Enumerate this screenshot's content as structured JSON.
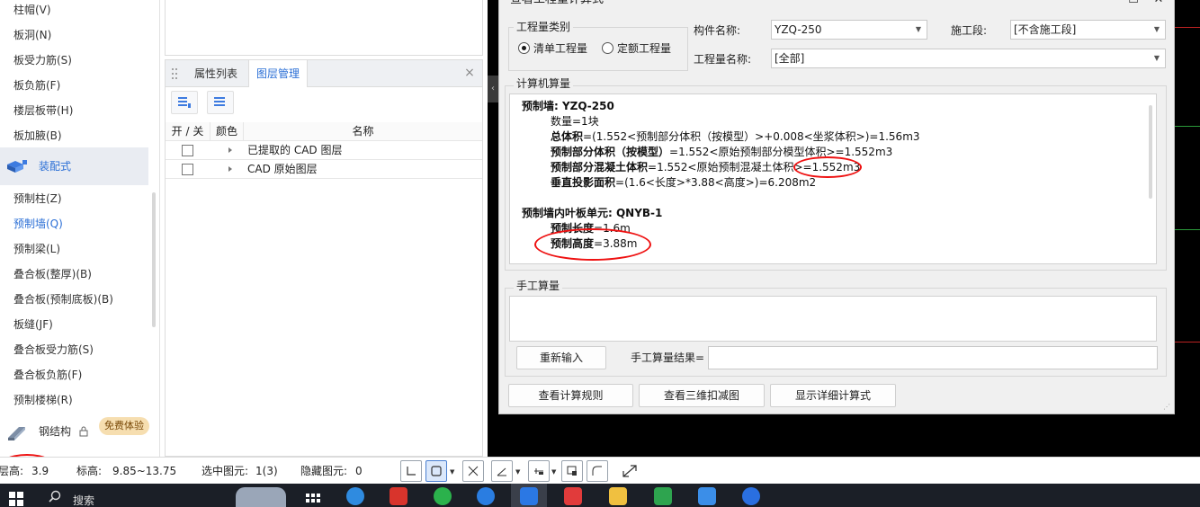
{
  "sidebar": {
    "items_top": [
      "柱帽(V)",
      "板洞(N)",
      "板受力筋(S)",
      "板负筋(F)",
      "楼层板带(H)",
      "板加腋(B)"
    ],
    "category_prefab": "装配式",
    "items_prefab": [
      "预制柱(Z)",
      "预制墙(Q)",
      "预制梁(L)",
      "叠合板(整厚)(B)",
      "叠合板(预制底板)(B)",
      "板缝(JF)",
      "叠合板受力筋(S)",
      "叠合板负筋(F)",
      "预制楼梯(R)"
    ],
    "active_item": "预制墙(Q)",
    "category_steel": "钢结构",
    "trial_badge": "免费体验"
  },
  "layer_panel": {
    "tabs": [
      "属性列表",
      "图层管理"
    ],
    "active_tab": "图层管理",
    "close": "×",
    "columns": [
      "开 / 关",
      "颜色",
      "名称"
    ],
    "rows": [
      {
        "name": "已提取的 CAD 图层",
        "checked": false
      },
      {
        "name": "CAD 原始图层",
        "checked": false
      }
    ]
  },
  "dialog": {
    "title": "查看工程量计算式",
    "controls": [
      "—",
      "☐",
      "✕"
    ],
    "quantity_type_group": "工程量类别",
    "radio_list": "清单工程量",
    "radio_quota": "定额工程量",
    "selected_type": "清单工程量",
    "component_label": "构件名称:",
    "component_value": "YZQ-250",
    "stage_label": "施工段:",
    "stage_value": "[不含施工段]",
    "qty_name_label": "工程量名称:",
    "qty_name_value": "[全部]",
    "computer_group": "计算机算量",
    "calc_lines": [
      {
        "bold": "预制墙: YZQ-250",
        "rest": ""
      },
      {
        "bold": "",
        "rest": "数量=1块"
      },
      {
        "bold": "总体积",
        "rest": "=(1.552<预制部分体积（按模型）>+0.008<坐浆体积>)=1.56m3"
      },
      {
        "bold": "预制部分体积（按模型）",
        "rest": "=1.552<原始预制部分模型体积>=1.552m3"
      },
      {
        "bold": "预制部分混凝土体积",
        "rest": "=1.552<原始预制混凝土体积>=1.552m3"
      },
      {
        "bold": "垂直投影面积",
        "rest": "=(1.6<长度>*3.88<高度>)=6.208m2"
      },
      {
        "bold": "预制墙内叶板单元: QNYB-1",
        "rest": ""
      },
      {
        "bold": "预制长度",
        "rest": "=1.6m"
      },
      {
        "bold": "预制高度",
        "rest": "=3.88m"
      }
    ],
    "manual_group": "手工算量",
    "reinput_button": "重新输入",
    "manual_result_label": "手工算量结果=",
    "manual_result_value": "",
    "btn_rules": "查看计算规则",
    "btn_3d": "查看三维扣减图",
    "btn_detail": "显示详细计算式"
  },
  "statusbar": {
    "floor_height_label": "层高:",
    "floor_height_value": "3.9",
    "elevation_label": "标高:",
    "elevation_value": "9.85~13.75",
    "selected_label": "选中图元:",
    "selected_value": "1(3)",
    "hidden_label": "隐藏图元:",
    "hidden_value": "0"
  },
  "taskbar": {
    "search_placeholder": "搜索"
  },
  "colors": {
    "accent_blue": "#2b6fd6",
    "annotation_red": "#e11111",
    "canvas_bg": "#000000",
    "trial_badge_bg": "#f6deb0"
  }
}
